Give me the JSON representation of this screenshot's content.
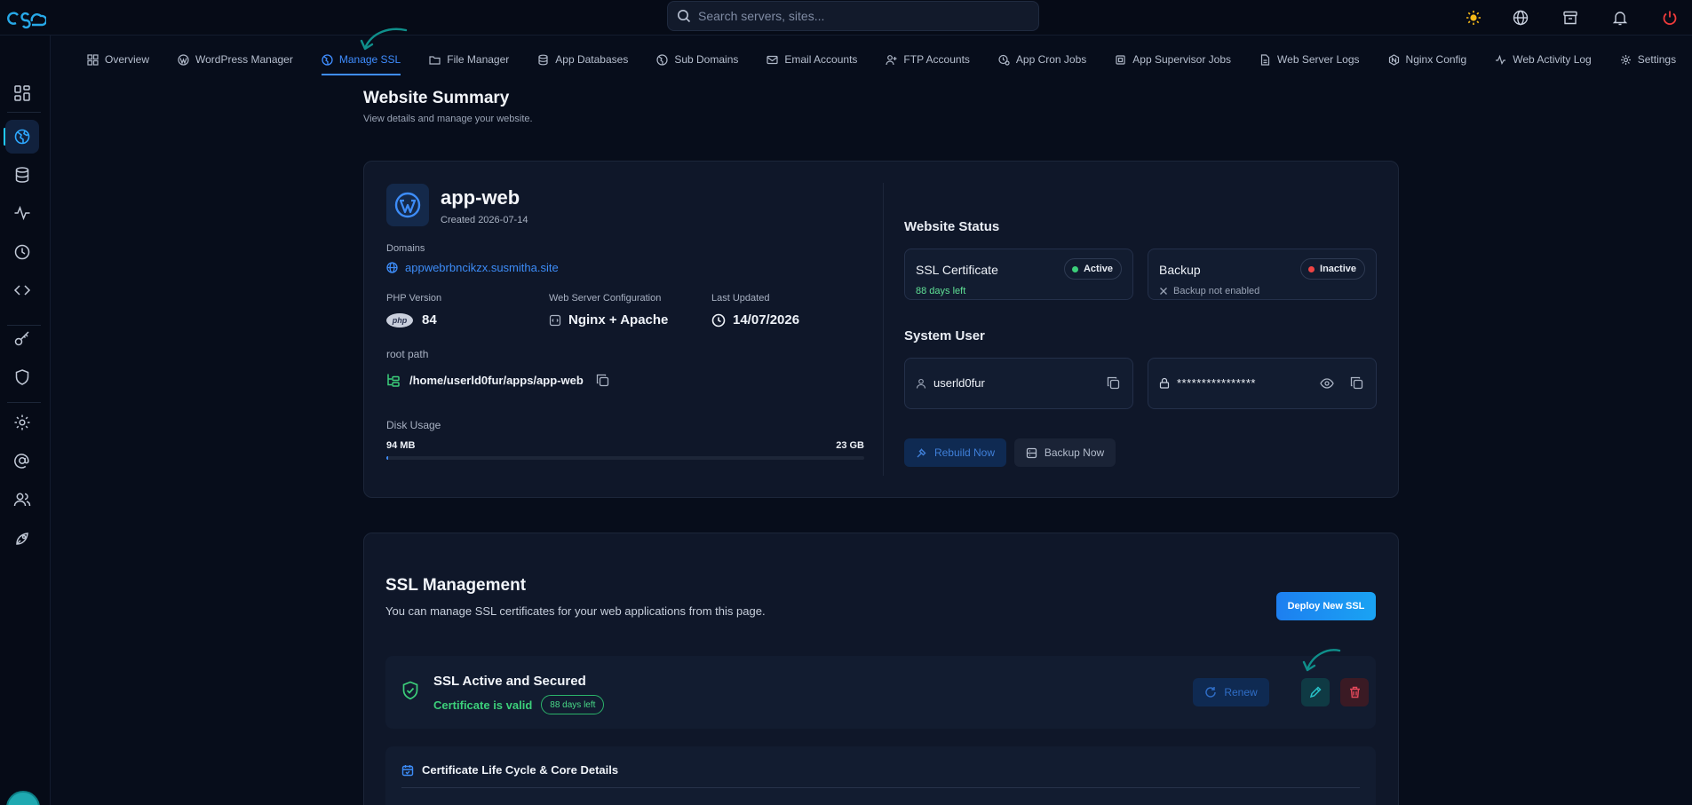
{
  "search": {
    "placeholder": "Search servers, sites..."
  },
  "tabs": [
    {
      "label": "Overview",
      "icon": "grid-icon"
    },
    {
      "label": "WordPress Manager",
      "icon": "wordpress-icon"
    },
    {
      "label": "Manage SSL",
      "icon": "globe-icon",
      "active": true
    },
    {
      "label": "File Manager",
      "icon": "folder-icon"
    },
    {
      "label": "App Databases",
      "icon": "database-icon"
    },
    {
      "label": "Sub Domains",
      "icon": "globe-icon"
    },
    {
      "label": "Email Accounts",
      "icon": "mail-icon"
    },
    {
      "label": "FTP Accounts",
      "icon": "user-plus-icon"
    },
    {
      "label": "App Cron Jobs",
      "icon": "clock-gear-icon"
    },
    {
      "label": "App Supervisor Jobs",
      "icon": "cpu-icon"
    },
    {
      "label": "Web Server Logs",
      "icon": "file-icon"
    },
    {
      "label": "Nginx Config",
      "icon": "nginx-icon"
    },
    {
      "label": "Web Activity Log",
      "icon": "activity-icon"
    },
    {
      "label": "Settings",
      "icon": "gear-icon"
    }
  ],
  "page": {
    "title": "Website Summary",
    "subtitle": "View details and manage your website."
  },
  "summary": {
    "app_name": "app-web",
    "created": "Created 2026-07-14",
    "domains_label": "Domains",
    "domain": "appwebrbncikzx.susmitha.site",
    "php_label": "PHP Version",
    "php_badge": "php",
    "php_value": "84",
    "webserver_label": "Web Server Configuration",
    "webserver_value": "Nginx + Apache",
    "updated_label": "Last Updated",
    "updated_value": "14/07/2026",
    "root_label": "root path",
    "root_value": "/home/userld0fur/apps/app-web",
    "disk_label": "Disk Usage",
    "disk_used": "94 MB",
    "disk_total": "23 GB",
    "disk_fraction": 0.004
  },
  "status": {
    "title": "Website Status",
    "ssl_title": "SSL Certificate",
    "ssl_badge": "Active",
    "ssl_note": "88 days left",
    "backup_title": "Backup",
    "backup_badge": "Inactive",
    "backup_note": "Backup not enabled",
    "system_user_title": "System User",
    "username": "userld0fur",
    "password": "****************",
    "rebuild_label": "Rebuild Now",
    "backup_label": "Backup Now"
  },
  "ssl": {
    "title": "SSL Management",
    "subtitle": "You can manage SSL certificates for your web applications from this page.",
    "deploy_label": "Deploy New SSL",
    "status_title": "SSL Active and Secured",
    "status_valid": "Certificate is valid",
    "days_left": "88 days left",
    "renew_label": "Renew",
    "lifecycle_title": "Certificate Life Cycle & Core Details"
  },
  "colors": {
    "accent": "#3f8dff",
    "active_green": "#3ccf7a",
    "inactive_red": "#ef4444",
    "background": "#070d1b",
    "card": "#0f1729"
  }
}
